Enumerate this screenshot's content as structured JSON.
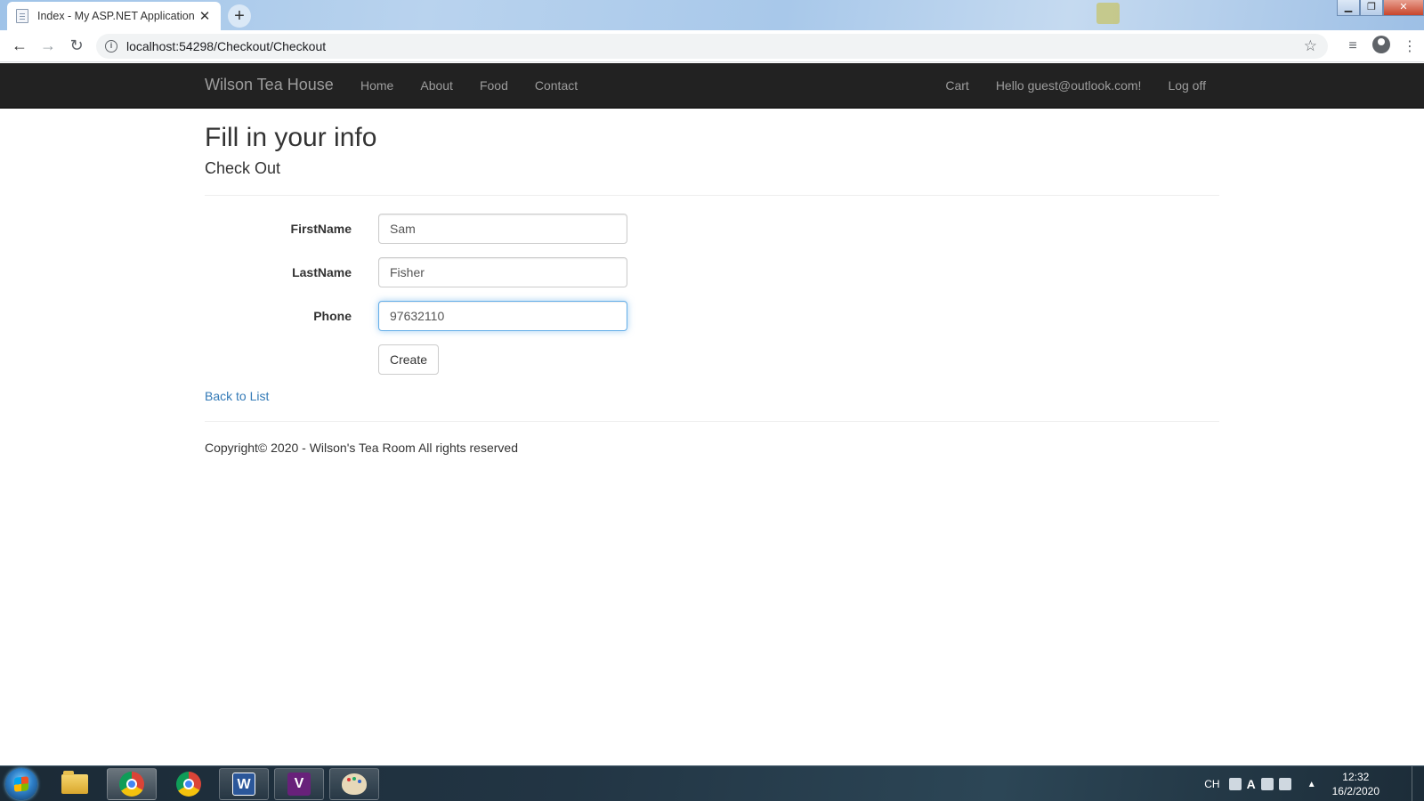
{
  "browser": {
    "tab_title": "Index - My ASP.NET Application",
    "url": "localhost:54298/Checkout/Checkout"
  },
  "navbar": {
    "brand": "Wilson Tea House",
    "left_links": [
      "Home",
      "About",
      "Food",
      "Contact"
    ],
    "right_links": [
      "Cart",
      "Hello guest@outlook.com!",
      "Log off"
    ]
  },
  "page": {
    "title": "Fill in your info",
    "subtitle": "Check Out"
  },
  "form": {
    "first_name": {
      "label": "FirstName",
      "value": "Sam"
    },
    "last_name": {
      "label": "LastName",
      "value": "Fisher"
    },
    "phone": {
      "label": "Phone",
      "value": "97632110"
    },
    "submit_label": "Create"
  },
  "back_link": "Back to List",
  "footer": "Copyright© 2020 - Wilson's Tea Room All rights reserved",
  "taskbar": {
    "language": "CH",
    "time": "12:32",
    "date": "16/2/2020"
  },
  "colors": {
    "navbar_bg": "#222222",
    "nav_text": "#9d9d9d",
    "link": "#337ab7",
    "focus_border": "#66afe9"
  }
}
